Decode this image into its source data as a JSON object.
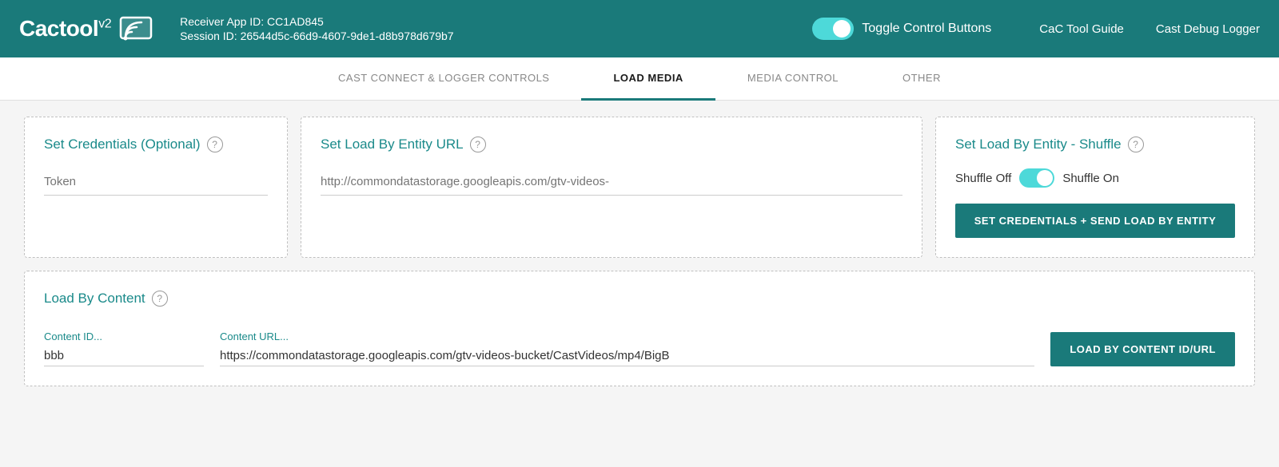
{
  "header": {
    "logo_text": "Cactool",
    "logo_v2": "v2",
    "receiver_app_id_label": "Receiver App ID: CC1AD845",
    "session_id_label": "Session ID: 26544d5c-66d9-4607-9de1-d8b978d679b7",
    "toggle_label": "Toggle Control Buttons",
    "toggle_on": true,
    "nav_link_guide": "CaC Tool Guide",
    "nav_link_logger": "Cast Debug Logger"
  },
  "tabs": [
    {
      "id": "cast-connect",
      "label": "CAST CONNECT & LOGGER CONTROLS",
      "active": false
    },
    {
      "id": "load-media",
      "label": "LOAD MEDIA",
      "active": true
    },
    {
      "id": "media-control",
      "label": "MEDIA CONTROL",
      "active": false
    },
    {
      "id": "other",
      "label": "OTHER",
      "active": false
    }
  ],
  "load_media": {
    "credentials_card": {
      "title": "Set Credentials (Optional)",
      "token_placeholder": "Token"
    },
    "entity_url_card": {
      "title": "Set Load By Entity URL",
      "url_placeholder": "http://commondatastorage.googleapis.com/gtv-videos-"
    },
    "shuffle_card": {
      "title": "Set Load By Entity - Shuffle",
      "shuffle_off_label": "Shuffle Off",
      "shuffle_on_label": "Shuffle On",
      "button_label": "SET CREDENTIALS + SEND LOAD BY ENTITY"
    },
    "load_content_card": {
      "title": "Load By Content",
      "content_id_label": "Content ID...",
      "content_id_value": "bbb",
      "content_url_label": "Content URL...",
      "content_url_value": "https://commondatastorage.googleapis.com/gtv-videos-bucket/CastVideos/mp4/BigB",
      "button_label": "LOAD BY CONTENT ID/URL"
    }
  },
  "icons": {
    "cast": "📡",
    "help": "?"
  }
}
